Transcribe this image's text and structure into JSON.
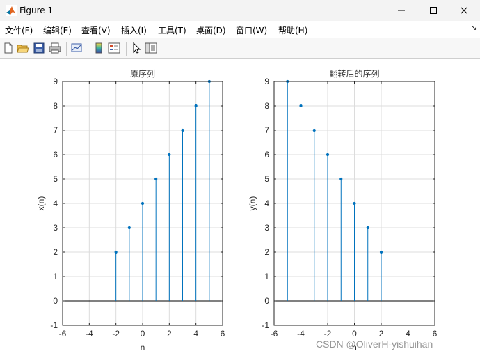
{
  "window": {
    "title": "Figure 1"
  },
  "menu": [
    "文件(F)",
    "编辑(E)",
    "查看(V)",
    "插入(I)",
    "工具(T)",
    "桌面(D)",
    "窗口(W)",
    "帮助(H)"
  ],
  "toolbar": {
    "icons": [
      "new-figure-icon",
      "open-icon",
      "save-icon",
      "print-icon",
      "link-plot-icon",
      "insert-colorbar-icon",
      "insert-legend-icon",
      "edit-plot-icon",
      "property-inspector-icon"
    ]
  },
  "colors": {
    "stem": "#0072bd",
    "grid": "#dcdcdc",
    "axis": "#262626"
  },
  "watermark": "CSDN @OliverH-yishuihan",
  "chart_data": [
    {
      "type": "stem",
      "title": "原序列",
      "xlabel": "n",
      "ylabel": "x(n)",
      "xlim": [
        -6,
        6
      ],
      "ylim": [
        -1,
        9
      ],
      "xticks": [
        "-6",
        "-4",
        "-2",
        "0",
        "2",
        "4",
        "6"
      ],
      "yticks": [
        "-1",
        "0",
        "1",
        "2",
        "3",
        "4",
        "5",
        "6",
        "7",
        "8",
        "9"
      ],
      "grid": true,
      "x": [
        -2,
        -1,
        0,
        1,
        2,
        3,
        4,
        5
      ],
      "y": [
        2,
        3,
        4,
        5,
        6,
        7,
        8,
        9
      ]
    },
    {
      "type": "stem",
      "title": "翻转后的序列",
      "xlabel": "n",
      "ylabel": "y(n)",
      "xlim": [
        -6,
        6
      ],
      "ylim": [
        -1,
        9
      ],
      "xticks": [
        "-6",
        "-4",
        "-2",
        "0",
        "2",
        "4",
        "6"
      ],
      "yticks": [
        "-1",
        "0",
        "1",
        "2",
        "3",
        "4",
        "5",
        "6",
        "7",
        "8",
        "9"
      ],
      "grid": true,
      "x": [
        -5,
        -4,
        -3,
        -2,
        -1,
        0,
        1,
        2
      ],
      "y": [
        9,
        8,
        7,
        6,
        5,
        4,
        3,
        2
      ]
    }
  ]
}
